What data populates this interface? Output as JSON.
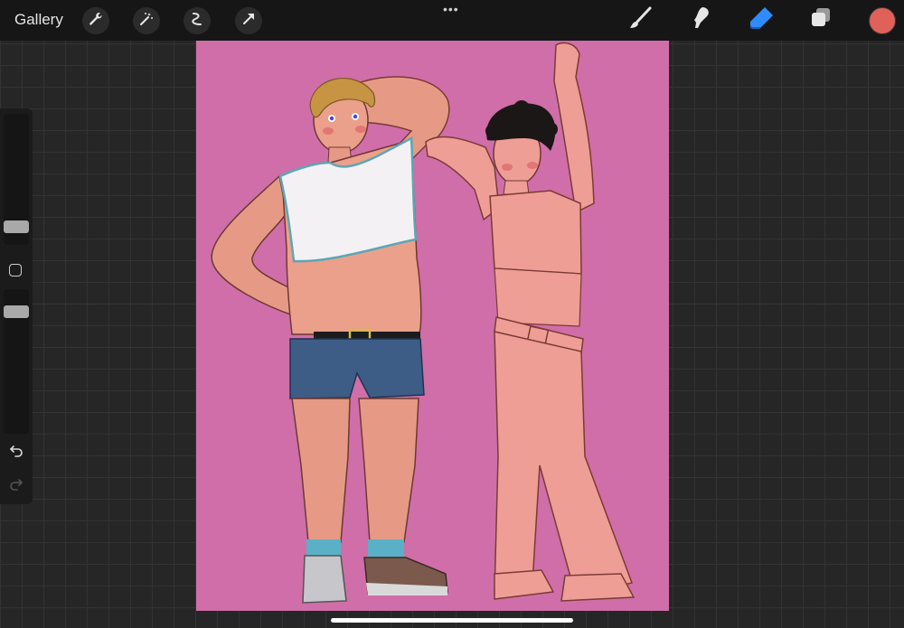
{
  "topbar": {
    "gallery_label": "Gallery",
    "more_label": "•••",
    "left_tools": [
      "wrench-icon",
      "magic-wand-icon",
      "selection-icon",
      "transform-arrow-icon"
    ],
    "right_tools": [
      "brush-icon",
      "smudge-icon",
      "eraser-icon",
      "layers-icon"
    ],
    "active_tool": "eraser-icon",
    "active_tool_color": "#2f8cff",
    "current_color": "#e06158"
  },
  "sidebar": {
    "brush_size": 0.1,
    "brush_opacity": 0.88
  },
  "canvas": {
    "background_color": "#d06ea9",
    "figures": [
      "man-in-white-crop-top-and-denim-shorts",
      "person-in-pink-crop-top-and-pink-pants"
    ]
  }
}
